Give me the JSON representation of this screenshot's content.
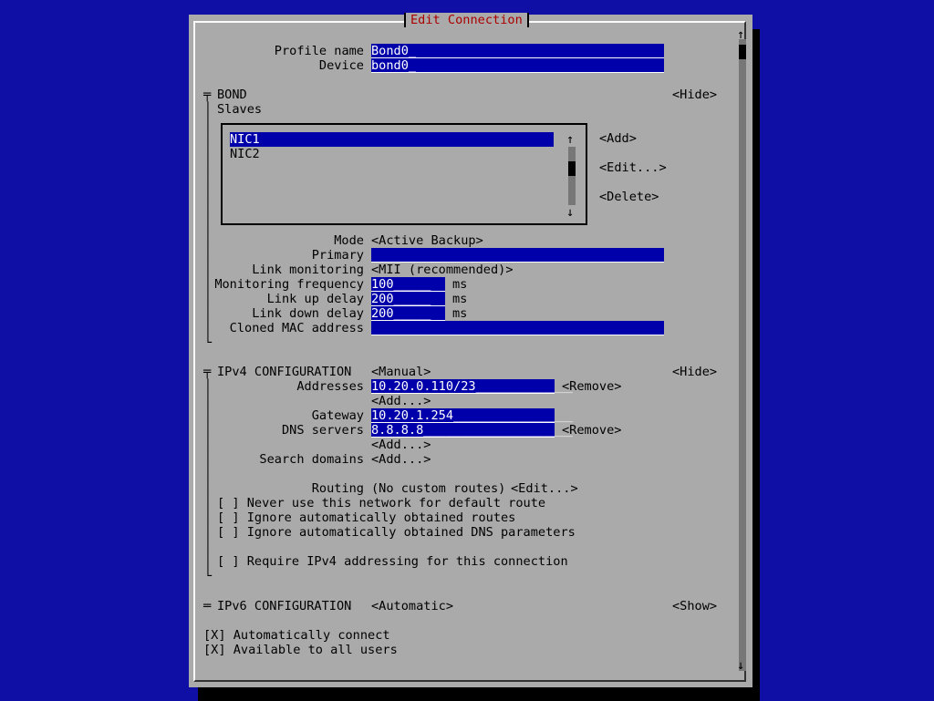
{
  "dialog": {
    "title": "Edit Connection"
  },
  "profile": {
    "name_label": "Profile name",
    "name_value": "Bond0_",
    "device_label": "Device",
    "device_value": "bond0_"
  },
  "bond": {
    "section_marker": "╤",
    "section": "BOND",
    "hide": "<Hide>",
    "slaves_label": "Slaves",
    "slaves": [
      "NIC1",
      "NIC2"
    ],
    "add": "<Add>",
    "edit": "<Edit...>",
    "delete": "<Delete>",
    "mode_label": "Mode",
    "mode_value": "<Active Backup>",
    "primary_label": "Primary",
    "primary_value": "",
    "link_mon_label": "Link monitoring",
    "link_mon_value": "<MII (recommended)>",
    "mon_freq_label": "Monitoring frequency",
    "mon_freq_value": "100_____",
    "mon_freq_unit": "ms",
    "up_delay_label": "Link up delay",
    "up_delay_value": "200_____",
    "up_delay_unit": "ms",
    "down_delay_label": "Link down delay",
    "down_delay_value": "200_____",
    "down_delay_unit": "ms",
    "mac_label": "Cloned MAC address",
    "mac_value": ""
  },
  "ipv4": {
    "section_marker": "╤",
    "section": "IPv4 CONFIGURATION",
    "method": "<Manual>",
    "hide": "<Hide>",
    "addresses_label": "Addresses",
    "address_value": "10.20.0.110/23_____________",
    "remove1": "<Remove>",
    "add1": "<Add...>",
    "gateway_label": "Gateway",
    "gateway_value": "10.20.1.254________________",
    "dns_label": "DNS servers",
    "dns_value": "8.8.8.8____________________",
    "remove2": "<Remove>",
    "add2": "<Add...>",
    "search_label": "Search domains",
    "search_add": "<Add...>",
    "routing_label": "Routing",
    "routing_value": "(No custom routes)",
    "routing_edit": "<Edit...>",
    "cb1": "[ ] Never use this network for default route",
    "cb2": "[ ] Ignore automatically obtained routes",
    "cb3": "[ ] Ignore automatically obtained DNS parameters",
    "cb4": "[ ] Require IPv4 addressing for this connection"
  },
  "ipv6": {
    "section_marker": "═",
    "section": "IPv6 CONFIGURATION",
    "method": "<Automatic>",
    "show": "<Show>"
  },
  "footer": {
    "auto_connect": "[X] Automatically connect",
    "all_users": "[X] Available to all users"
  },
  "glyphs": {
    "up": "↑",
    "down": "↓",
    "bar": "│",
    "corner": "└"
  },
  "colors": {
    "background": "#0f0fa6",
    "dialog": "#aaaaaa",
    "field": "#0000aa",
    "title": "#aa0000"
  }
}
